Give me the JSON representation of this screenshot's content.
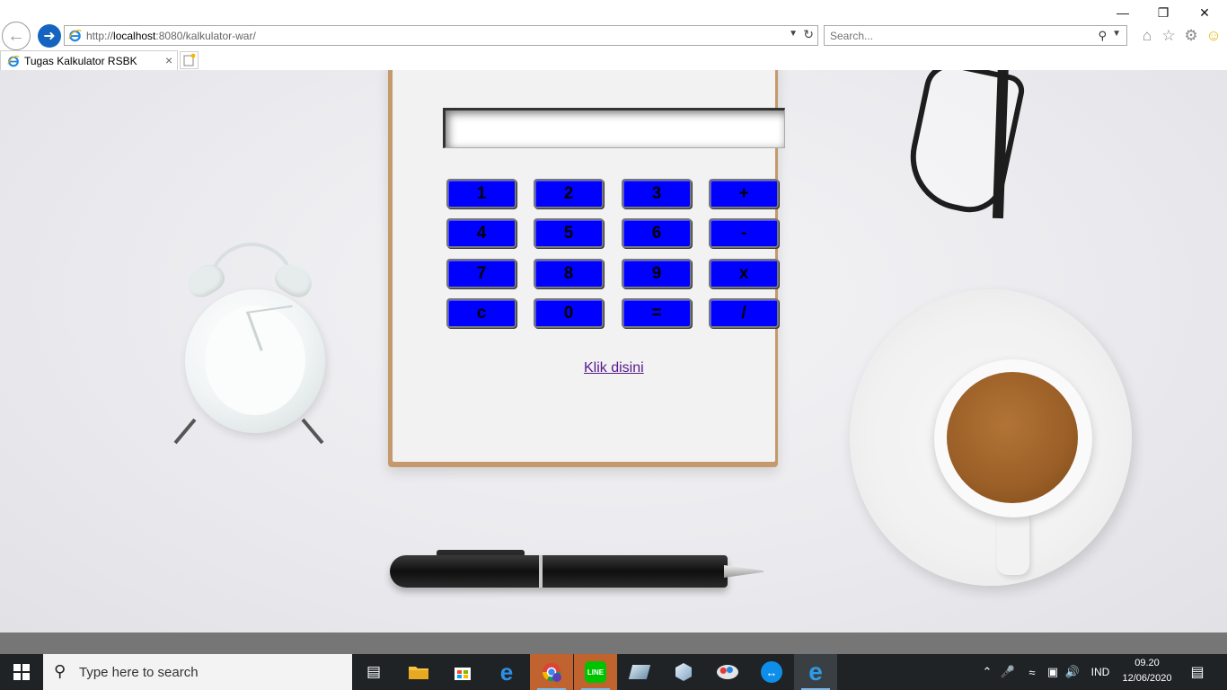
{
  "window": {
    "minimize_glyph": "—",
    "restore_glyph": "❐",
    "close_glyph": "✕"
  },
  "address": {
    "prefix": "http://",
    "host": "localhost",
    "path": ":8080/kalkulator-war/"
  },
  "search": {
    "placeholder": "Search..."
  },
  "tab": {
    "title": "Tugas Kalkulator RSBK"
  },
  "calculator": {
    "display_value": "",
    "keys": [
      "1",
      "2",
      "3",
      "+",
      "4",
      "5",
      "6",
      "-",
      "7",
      "8",
      "9",
      "x",
      "c",
      "0",
      "=",
      "/"
    ],
    "link_text": "Klik disini"
  },
  "taskbar": {
    "search_text": "Type here to search",
    "language": "IND",
    "time": "09.20",
    "date": "12/06/2020"
  },
  "colors": {
    "key_background": "#0000ff",
    "link_visited": "#551a8b"
  }
}
